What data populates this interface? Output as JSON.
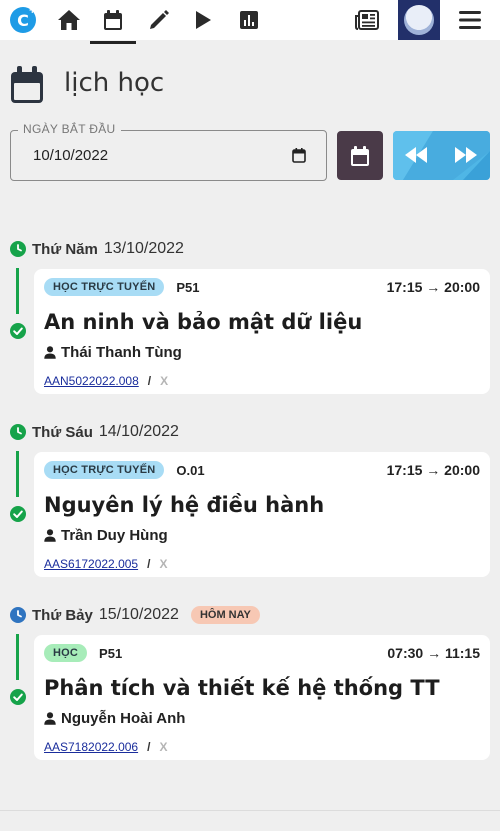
{
  "nav": {
    "logo_text": "C",
    "logo_plus": "+",
    "items": [
      {
        "icon": "home-icon"
      },
      {
        "icon": "calendar-icon",
        "active": true
      },
      {
        "icon": "pencil-icon"
      },
      {
        "icon": "play-icon"
      },
      {
        "icon": "bar-chart-icon"
      },
      {
        "icon": "newspaper-icon"
      },
      {
        "icon": "avatar"
      },
      {
        "icon": "hamburger-menu-icon"
      }
    ]
  },
  "page": {
    "title": "lịch học"
  },
  "date_filter": {
    "label": "NGÀY BẮT ĐẦU",
    "value": "10/10/2022"
  },
  "colors": {
    "accent_green": "#16a34a",
    "today_blue": "#2f74c0",
    "online_badge": "#a8dcf5",
    "class_badge": "#a7ecb9",
    "today_badge": "#f7c8b4",
    "calendar_button": "#4a3a48",
    "nav_button": "#4fb6e6"
  },
  "days": [
    {
      "weekday": "Thứ Năm",
      "date": "13/10/2022",
      "is_today": false,
      "sessions": [
        {
          "type": "HỌC TRỰC TUYẾN",
          "room": "P51",
          "time": "17:15 → 20:00",
          "subject": "An ninh và bảo mật dữ liệu",
          "teacher": "Thái Thanh Tùng",
          "code": "AAN5022022.008",
          "separator": "/",
          "extra": "X"
        }
      ]
    },
    {
      "weekday": "Thứ Sáu",
      "date": "14/10/2022",
      "is_today": false,
      "sessions": [
        {
          "type": "HỌC TRỰC TUYẾN",
          "room": "O.01",
          "time": "17:15 → 20:00",
          "subject": "Nguyên lý hệ điều hành",
          "teacher": "Trần Duy Hùng",
          "code": "AAS6172022.005",
          "separator": "/",
          "extra": "X"
        }
      ]
    },
    {
      "weekday": "Thứ Bảy",
      "date": "15/10/2022",
      "is_today": true,
      "today_label": "HÔM NAY",
      "sessions": [
        {
          "type": "HỌC",
          "room": "P51",
          "time": "07:30 → 11:15",
          "subject": "Phân tích và thiết kế hệ thống TT",
          "teacher": "Nguyễn Hoài Anh",
          "code": "AAS7182022.006",
          "separator": "/",
          "extra": "X"
        }
      ]
    }
  ]
}
